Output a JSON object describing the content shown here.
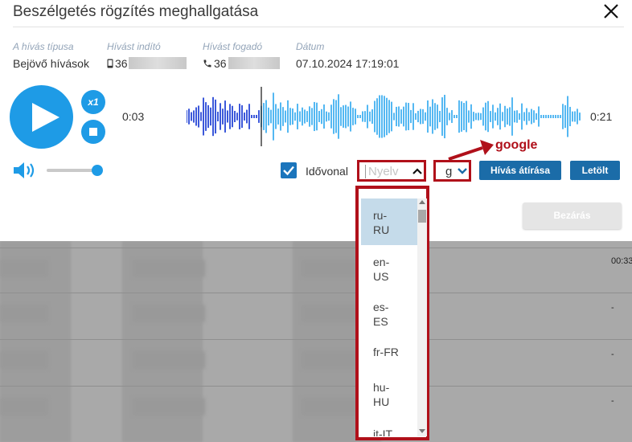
{
  "dialog": {
    "title": "Beszélgetés rögzítés meghallgatása",
    "info": {
      "call_type_label": "A hívás típusa",
      "call_type_value": "Bejövő hívások",
      "caller_label": "Hívást indító",
      "caller_value": "36",
      "receiver_label": "Hívást fogadó",
      "receiver_value": "36",
      "date_label": "Dátum",
      "date_value": "07.10.2024 17:19:01"
    },
    "player": {
      "speed_label": "x1",
      "current_time": "0:03",
      "total_time": "0:21",
      "progress": 0.18,
      "volume": 1.0
    },
    "controls": {
      "timeline_label": "Idővonal",
      "timeline_checked": true,
      "language_placeholder": "Nyelv",
      "engine_value": "g",
      "transcribe_button": "Hívás átírása",
      "download_button": "Letölt",
      "close_button": "Bezárás"
    },
    "annotation": {
      "google_label": "google"
    },
    "language_options": [
      "ru-RU",
      "en-US",
      "es-ES",
      "fr-FR",
      "hu-HU",
      "it-IT"
    ],
    "selected_language_option": "ru-RU"
  },
  "background": {
    "row_tail_values": [
      "00:33",
      "-",
      "-",
      "-"
    ]
  },
  "colors": {
    "accent": "#1e9be6",
    "button": "#1b6ca8",
    "annotation": "#b0101a"
  }
}
